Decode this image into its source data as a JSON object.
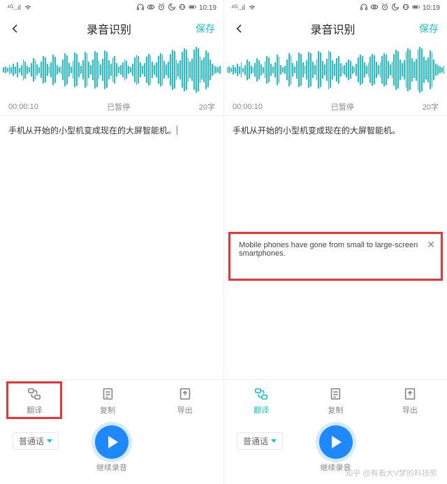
{
  "statusbar": {
    "time": "10:19"
  },
  "header": {
    "title": "录音识别",
    "save": "保存"
  },
  "status": {
    "time": "00:00:10",
    "state": "已暂停",
    "wc": "20字"
  },
  "transcript": "手机从开始的小型机变成现在的大屏智能机。",
  "translation": "Mobile phones have gone from small to large-screen smartphones.",
  "tools": {
    "translate": "翻译",
    "copy": "复制",
    "export": "导出"
  },
  "lang": "普通话",
  "play": {
    "continue": "继续录音"
  },
  "watermark": "知乎 @有着大V梦的科技熊",
  "wave": [
    8,
    10,
    6,
    14,
    9,
    18,
    11,
    22,
    7,
    15,
    30,
    25,
    12,
    8,
    20,
    34,
    28,
    16,
    9,
    24,
    40,
    36,
    18,
    10,
    22,
    44,
    38,
    14,
    8,
    12,
    30,
    48,
    42,
    20,
    10,
    26,
    50,
    46,
    22,
    12,
    28,
    52,
    48,
    24,
    14,
    30,
    54,
    50,
    26,
    16,
    32,
    56,
    52,
    28,
    18,
    34,
    40,
    20,
    10,
    14,
    22,
    30,
    26,
    12,
    8,
    18,
    36,
    44,
    40,
    22,
    12,
    20,
    38,
    46,
    42,
    24,
    14,
    22,
    40,
    48,
    44,
    26,
    16,
    24,
    46,
    58,
    54,
    30,
    20,
    28,
    52,
    62,
    58,
    34,
    24,
    32,
    58,
    66,
    62,
    38,
    28,
    36,
    56,
    50,
    30,
    18,
    14,
    10,
    8,
    12
  ]
}
